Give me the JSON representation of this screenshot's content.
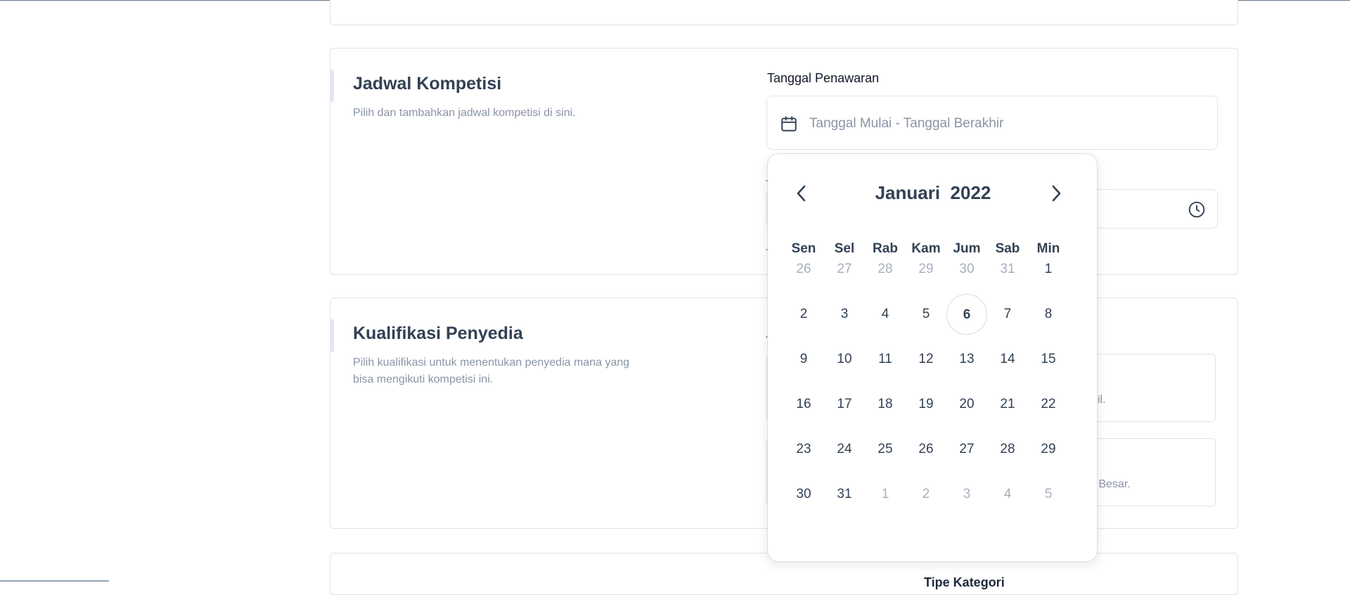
{
  "jadwal": {
    "title": "Jadwal Kompetisi",
    "description": "Pilih dan tambahkan jadwal kompetisi di sini.",
    "field_label": "Tanggal Penawaran",
    "date_placeholder": "Tanggal Mulai - Tanggal Berakhir"
  },
  "kualifikasi": {
    "title": "Kualifikasi Penyedia",
    "description": "Pilih kualifikasi untuk menentukan penyedia mana yang bisa mengikuti kompetisi ini.",
    "option1_tail": "il.",
    "option2_tail": "n Besar."
  },
  "bottom_section": {
    "label": "Tipe Kategori"
  },
  "calendar": {
    "month": "Januari",
    "year": "2022",
    "weekdays": [
      "Sen",
      "Sel",
      "Rab",
      "Kam",
      "Jum",
      "Sab",
      "Min"
    ],
    "weeks": [
      [
        {
          "d": "26",
          "m": true
        },
        {
          "d": "27",
          "m": true
        },
        {
          "d": "28",
          "m": true
        },
        {
          "d": "29",
          "m": true
        },
        {
          "d": "30",
          "m": true
        },
        {
          "d": "31",
          "m": true
        },
        {
          "d": "1"
        }
      ],
      [
        {
          "d": "2"
        },
        {
          "d": "3"
        },
        {
          "d": "4"
        },
        {
          "d": "5"
        },
        {
          "d": "6",
          "today": true
        },
        {
          "d": "7"
        },
        {
          "d": "8"
        }
      ],
      [
        {
          "d": "9"
        },
        {
          "d": "10"
        },
        {
          "d": "11"
        },
        {
          "d": "12"
        },
        {
          "d": "13"
        },
        {
          "d": "14"
        },
        {
          "d": "15"
        }
      ],
      [
        {
          "d": "16"
        },
        {
          "d": "17"
        },
        {
          "d": "18"
        },
        {
          "d": "19"
        },
        {
          "d": "20"
        },
        {
          "d": "21"
        },
        {
          "d": "22"
        }
      ],
      [
        {
          "d": "23"
        },
        {
          "d": "24"
        },
        {
          "d": "25"
        },
        {
          "d": "26"
        },
        {
          "d": "27"
        },
        {
          "d": "28"
        },
        {
          "d": "29"
        }
      ],
      [
        {
          "d": "30"
        },
        {
          "d": "31"
        },
        {
          "d": "1",
          "m": true
        },
        {
          "d": "2",
          "m": true
        },
        {
          "d": "3",
          "m": true
        },
        {
          "d": "4",
          "m": true
        },
        {
          "d": "5",
          "m": true
        }
      ]
    ]
  },
  "icons": {
    "date_input": "calendar-icon",
    "time_input": "clock-icon",
    "prev": "chevron-left-icon",
    "next": "chevron-right-icon"
  },
  "colors": {
    "heading": "#334155",
    "muted_text": "#8a94a6",
    "border": "#dfe3ea"
  }
}
